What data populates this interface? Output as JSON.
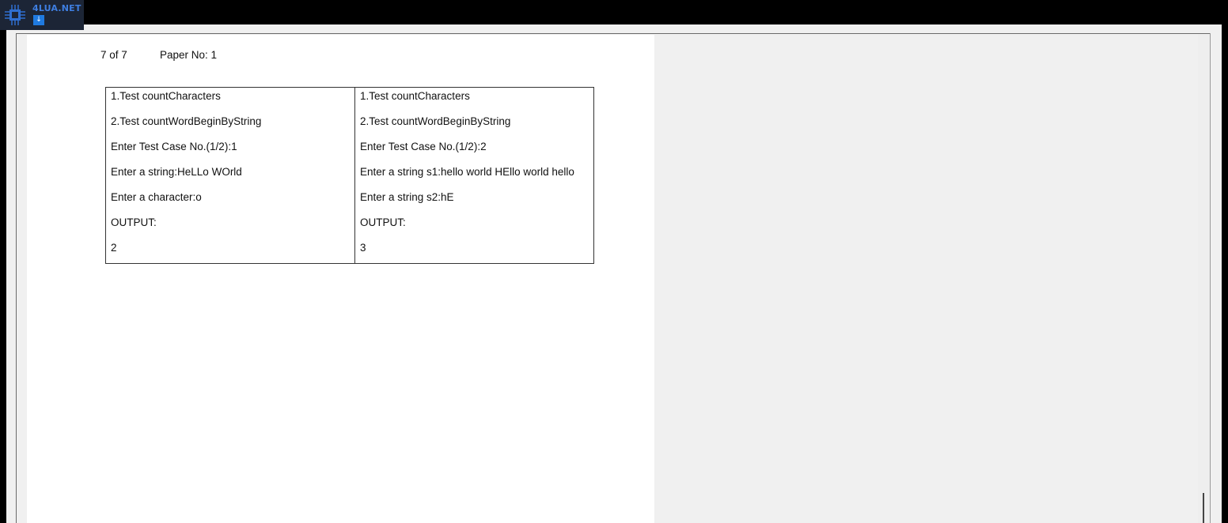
{
  "logo": {
    "text": "4LUA.NET",
    "badge": "↓",
    "icon": "chip-icon"
  },
  "page_header": {
    "page_counter": "7 of 7",
    "paper_no": "Paper No: 1"
  },
  "test_table": {
    "column_1": [
      "1.Test countCharacters",
      "2.Test countWordBeginByString",
      "Enter Test Case No.(1/2):1",
      "Enter a string:HeLLo WOrld",
      "Enter a character:o",
      "OUTPUT:",
      "2"
    ],
    "column_2": [
      "1.Test countCharacters",
      "2.Test countWordBeginByString",
      "Enter Test Case No.(1/2):2",
      "Enter a string s1:hello world HEllo world hello",
      "Enter a string s2:hE",
      "OUTPUT:",
      "3"
    ]
  },
  "colors": {
    "viewer_background": "#f0f0f0",
    "page_background": "#ffffff",
    "logo_accent": "#3e7ee0"
  }
}
